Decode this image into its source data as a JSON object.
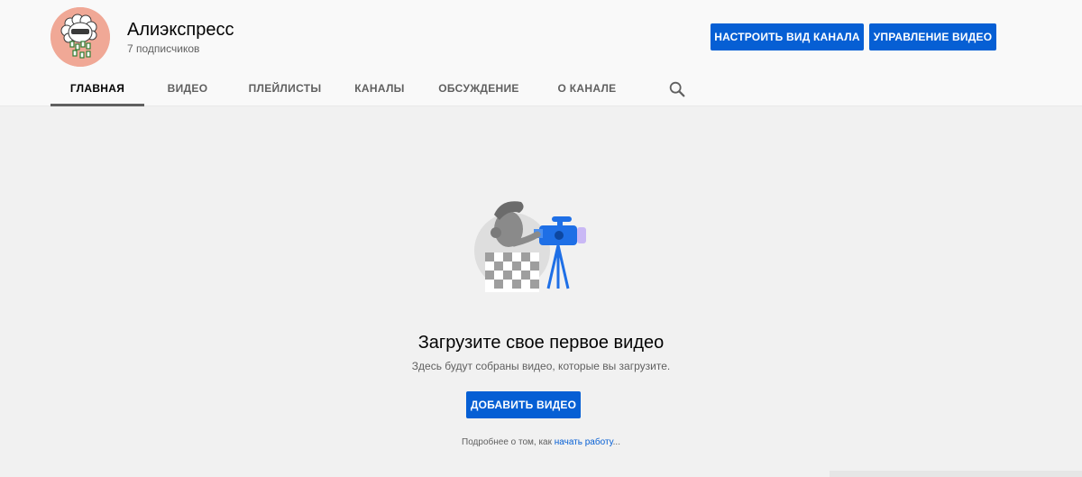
{
  "channel": {
    "name": "Алиэкспресс",
    "subscribers": "7 подписчиков"
  },
  "header_buttons": {
    "customize": "НАСТРОИТЬ ВИД КАНАЛА",
    "manage": "УПРАВЛЕНИЕ ВИДЕО"
  },
  "tabs": [
    {
      "label": "ГЛАВНАЯ",
      "active": true
    },
    {
      "label": "ВИДЕО",
      "active": false
    },
    {
      "label": "ПЛЕЙЛИСТЫ",
      "active": false
    },
    {
      "label": "КАНАЛЫ",
      "active": false
    },
    {
      "label": "ОБСУЖДЕНИЕ",
      "active": false
    },
    {
      "label": "О КАНАЛЕ",
      "active": false
    }
  ],
  "search_icon": "search-icon",
  "empty_state": {
    "title": "Загрузите свое первое видео",
    "subtitle": "Здесь будут собраны видео, которые вы загрузите.",
    "add_button": "ДОБАВИТЬ ВИДЕО",
    "learn_more_prefix": "Подробнее о том, как ",
    "learn_more_link": "начать работу",
    "learn_more_suffix": "..."
  },
  "colors": {
    "accent": "#065fd4",
    "avatar_bg": "#f0a896",
    "header_bg": "#f9f9f9",
    "page_bg": "#f1f1f1"
  }
}
